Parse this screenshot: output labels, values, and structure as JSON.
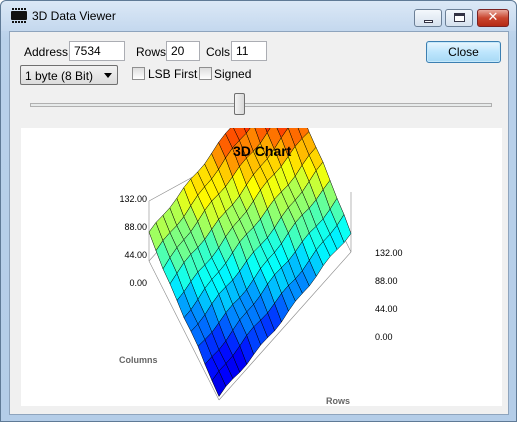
{
  "window": {
    "title": "3D Data Viewer"
  },
  "controls": {
    "address_label": "Address",
    "address_value": "7534",
    "rows_label": "Rows",
    "rows_value": "20",
    "cols_label": "Cols",
    "cols_value": "11",
    "data_type_value": "1 byte (8 Bit)",
    "lsb_first_label": "LSB First",
    "lsb_first_checked": false,
    "signed_label": "Signed",
    "signed_checked": false,
    "close_label": "Close",
    "slider_fraction": 0.46
  },
  "chart_data": {
    "type": "surface",
    "title": "3D Chart",
    "axis_rows_label": "Rows",
    "axis_columns_label": "Columns",
    "z_ticks_left": [
      "132.00",
      "88.00",
      "44.00",
      "0.00"
    ],
    "z_ticks_right": [
      "132.00",
      "88.00",
      "44.00",
      "0.00"
    ],
    "zlim": [
      0,
      132
    ],
    "rows": 20,
    "cols": 11,
    "colormap": "jet",
    "color_low": "#0000ff",
    "color_high": "#ff0000"
  }
}
